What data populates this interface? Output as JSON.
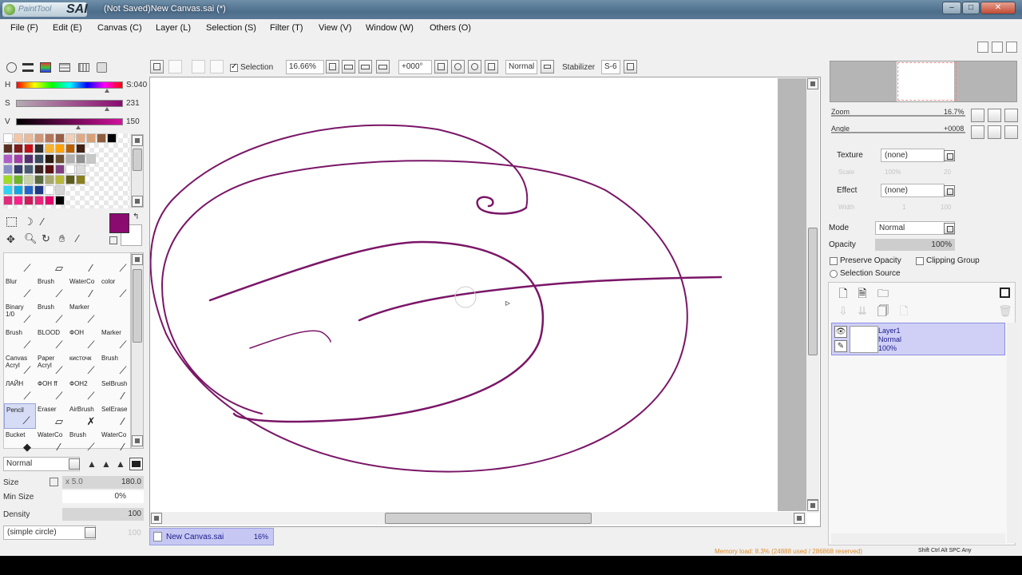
{
  "window": {
    "title": "(Not Saved)New Canvas.sai (*)",
    "logo": {
      "small": "PaintTool",
      "big": "SAI"
    }
  },
  "menu": [
    "File (F)",
    "Edit (E)",
    "Canvas (C)",
    "Layer (L)",
    "Selection (S)",
    "Filter (T)",
    "View (V)",
    "Window (W)",
    "Others (O)"
  ],
  "toolbar": {
    "selection_label": "Selection",
    "selection_checked": true,
    "zoom": "16.66%",
    "angle": "+000°",
    "blend_mode": "Normal",
    "stabilizer_label": "Stabilizer",
    "stabilizer_value": "S-6"
  },
  "color": {
    "primary": "#8b0a6f",
    "sliders": [
      {
        "label": "H",
        "value": "S:040"
      },
      {
        "label": "S",
        "value": "231"
      },
      {
        "label": "V",
        "value": "150"
      }
    ],
    "swatches": [
      [
        "#ffffff",
        "#f4c6a8",
        "#e9b99a",
        "#cf9677",
        "#b5775c",
        "#976047",
        "#f2d0b8",
        "#e0a985",
        "#d9a077",
        "#8f5d3d",
        "#000000"
      ],
      [
        "#5a2f22",
        "#7f1c1c",
        "#c1121b",
        "#2d2d2d",
        "#f4b432",
        "#ffa200",
        "#b86100",
        "#401f14"
      ],
      [
        "#b05cc9",
        "#a43fa7",
        "#54306d",
        "#39495d",
        "#2b1b0f",
        "#6b4e2f",
        "#b0b0b0",
        "#8f8f8f",
        "#c8c8c8"
      ],
      [
        "#8b8fc9",
        "#363c6b",
        "#495b73",
        "#3d2424",
        "#5a0f10",
        "#7f3f7f",
        "#ffffff",
        "#dcdcdc"
      ],
      [
        "#9fdc28",
        "#6fb526",
        "#c7d3a7",
        "#5a6b3f",
        "#a8a86e",
        "#b7b738",
        "#5c5c1d",
        "#8a7f1f"
      ],
      [
        "#2fd2f3",
        "#14a6e0",
        "#2366c8",
        "#1f3a85",
        "#ffffff",
        "#d4d4d4"
      ],
      [
        "#e02a7c",
        "#ff1f8a",
        "#cc1c5c",
        "#e6247a",
        "#e2086a",
        "#000000"
      ]
    ]
  },
  "tools": [
    [
      {
        "label": "",
        "icon": "pen-icon"
      },
      {
        "label": "",
        "icon": "eraser-icon"
      },
      {
        "label": "",
        "icon": "watercolor-icon"
      },
      {
        "label": "",
        "icon": "color-icon"
      }
    ],
    [
      {
        "label": "Blur",
        "icon": "blur-icon"
      },
      {
        "label": "Brush",
        "icon": "brush-icon"
      },
      {
        "label": "WaterCo",
        "icon": "watercolor-icon"
      },
      {
        "label": "color",
        "icon": "color-icon"
      }
    ],
    [
      {
        "label": "Binary\n1/0",
        "icon": "pen-icon"
      },
      {
        "label": "Brush",
        "icon": "brush-icon"
      },
      {
        "label": "Marker",
        "icon": "marker-icon"
      },
      {
        "label": "",
        "icon": ""
      }
    ],
    [
      {
        "label": "Brush",
        "icon": "brush-icon"
      },
      {
        "label": "BLOOD",
        "icon": "blood-icon"
      },
      {
        "label": "ФОН",
        "icon": "brush-icon"
      },
      {
        "label": "Marker",
        "icon": "marker-icon"
      }
    ],
    [
      {
        "label": "Canvas\nAcryl",
        "icon": "canvas-icon"
      },
      {
        "label": "Paper\nAcryl",
        "icon": "paper-icon"
      },
      {
        "label": "кисточк",
        "icon": "brush-icon"
      },
      {
        "label": "Brush",
        "icon": "brush-icon"
      }
    ],
    [
      {
        "label": "ЛАЙН",
        "icon": "line-icon"
      },
      {
        "label": "ФОН ff",
        "icon": "brush-icon"
      },
      {
        "label": "ФОН2",
        "icon": "brush-icon"
      },
      {
        "label": "SelBrush",
        "icon": "selbrush-icon"
      }
    ],
    [
      {
        "label": "Pencil",
        "icon": "pencil-icon",
        "selected": true
      },
      {
        "label": "Eraser",
        "icon": "eraser-icon"
      },
      {
        "label": "AirBrush",
        "icon": "airbrush-icon"
      },
      {
        "label": "SelErase",
        "icon": "selerase-icon"
      }
    ],
    [
      {
        "label": "Bucket",
        "icon": "bucket-icon"
      },
      {
        "label": "WaterCo",
        "icon": "watercolor-icon"
      },
      {
        "label": "Brush",
        "icon": "brush-icon"
      },
      {
        "label": "WaterCo",
        "icon": "watercolor-icon"
      }
    ]
  ],
  "brush": {
    "mode": "Normal",
    "size_label": "Size",
    "size_mult": "x 5.0",
    "size_value": "180.0",
    "minsize_label": "Min Size",
    "minsize_value": "0%",
    "density_label": "Density",
    "density_value": "100",
    "shape": "(simple circle)",
    "shape_value": "100"
  },
  "canvas_tab": {
    "name": "New Canvas.sai",
    "zoom": "16%"
  },
  "navigator": {
    "zoom_label": "Zoom",
    "zoom_value": "16.7%",
    "angle_label": "Angle",
    "angle_value": "+0008"
  },
  "texture": {
    "label": "Texture",
    "value": "(none)",
    "sub_label": "Scale",
    "sub_value": "100%",
    "sub_value2": "20"
  },
  "effect": {
    "label": "Effect",
    "value": "(none)",
    "sub_label": "Width",
    "sub_value": "1",
    "sub_value2": "100"
  },
  "layer_props": {
    "mode_label": "Mode",
    "mode_value": "Normal",
    "opacity_label": "Opacity",
    "opacity_value": "100%",
    "preserve_opacity": "Preserve Opacity",
    "clipping_group": "Clipping Group",
    "selection_source": "Selection Source"
  },
  "layers": [
    {
      "name": "Layer1",
      "mode": "Normal",
      "opacity": "100%"
    }
  ],
  "status": {
    "memory": "Memory load: 8.3% (24888 used / 286868 reserved)",
    "keys": "Shift Ctrl Alt SPC  Any"
  }
}
